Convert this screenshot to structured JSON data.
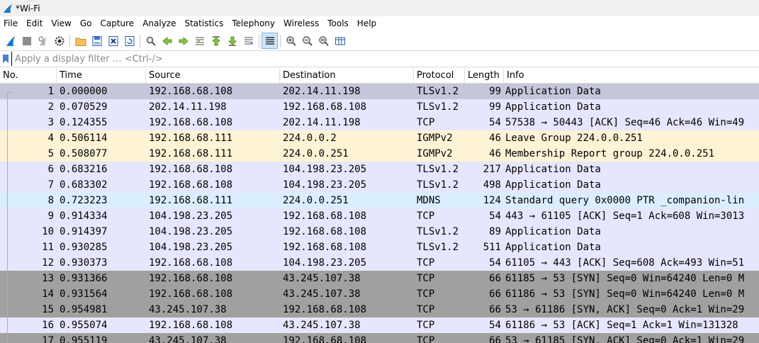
{
  "window": {
    "title": "*Wi-Fi"
  },
  "menu": [
    "File",
    "Edit",
    "View",
    "Go",
    "Capture",
    "Analyze",
    "Statistics",
    "Telephony",
    "Wireless",
    "Tools",
    "Help"
  ],
  "toolbar": {
    "icons": [
      "shark-fin-start-icon",
      "stop-square-icon",
      "restart-capture-icon",
      "capture-options-gear-icon",
      "open-folder-icon",
      "save-file-icon",
      "close-file-icon",
      "reload-file-icon",
      "find-packet-icon",
      "go-back-icon",
      "go-forward-icon",
      "go-to-packet-icon",
      "go-first-icon",
      "go-last-icon",
      "autoscroll-icon",
      "colorize-icon",
      "zoom-in-icon",
      "zoom-out-icon",
      "zoom-normal-icon",
      "resize-columns-icon"
    ]
  },
  "filter": {
    "placeholder": "Apply a display filter … <Ctrl-/>"
  },
  "columns": {
    "no": "No.",
    "time": "Time",
    "source": "Source",
    "destination": "Destination",
    "protocol": "Protocol",
    "length": "Length",
    "info": "Info"
  },
  "colors": {
    "tcp": "#e7e6ff",
    "udp": "#daeeff",
    "igmp": "#fff3d6",
    "syn": "#a0a0a0",
    "selected": "#c5c5d8"
  },
  "packets": [
    {
      "no": "1",
      "time": "0.000000",
      "src": "192.168.68.108",
      "dst": "202.14.11.198",
      "proto": "TLSv1.2",
      "len": "99",
      "info": "Application Data",
      "color": "#c6c6da"
    },
    {
      "no": "2",
      "time": "0.070529",
      "src": "202.14.11.198",
      "dst": "192.168.68.108",
      "proto": "TLSv1.2",
      "len": "99",
      "info": "Application Data",
      "color": "#e7e6ff"
    },
    {
      "no": "3",
      "time": "0.124355",
      "src": "192.168.68.108",
      "dst": "202.14.11.198",
      "proto": "TCP",
      "len": "54",
      "info": "57538 → 50443 [ACK] Seq=46 Ack=46 Win=49",
      "color": "#e7e6ff"
    },
    {
      "no": "4",
      "time": "0.506114",
      "src": "192.168.68.111",
      "dst": "224.0.0.2",
      "proto": "IGMPv2",
      "len": "46",
      "info": "Leave Group 224.0.0.251",
      "color": "#fff3d6"
    },
    {
      "no": "5",
      "time": "0.508077",
      "src": "192.168.68.111",
      "dst": "224.0.0.251",
      "proto": "IGMPv2",
      "len": "46",
      "info": "Membership Report group 224.0.0.251",
      "color": "#fff3d6"
    },
    {
      "no": "6",
      "time": "0.683216",
      "src": "192.168.68.108",
      "dst": "104.198.23.205",
      "proto": "TLSv1.2",
      "len": "217",
      "info": "Application Data",
      "color": "#e7e6ff"
    },
    {
      "no": "7",
      "time": "0.683302",
      "src": "192.168.68.108",
      "dst": "104.198.23.205",
      "proto": "TLSv1.2",
      "len": "498",
      "info": "Application Data",
      "color": "#e7e6ff"
    },
    {
      "no": "8",
      "time": "0.723223",
      "src": "192.168.68.111",
      "dst": "224.0.0.251",
      "proto": "MDNS",
      "len": "124",
      "info": "Standard query 0x0000 PTR _companion-lin",
      "color": "#daeeff"
    },
    {
      "no": "9",
      "time": "0.914334",
      "src": "104.198.23.205",
      "dst": "192.168.68.108",
      "proto": "TCP",
      "len": "54",
      "info": "443 → 61105 [ACK] Seq=1 Ack=608 Win=3013",
      "color": "#e7e6ff"
    },
    {
      "no": "10",
      "time": "0.914397",
      "src": "104.198.23.205",
      "dst": "192.168.68.108",
      "proto": "TLSv1.2",
      "len": "89",
      "info": "Application Data",
      "color": "#e7e6ff"
    },
    {
      "no": "11",
      "time": "0.930285",
      "src": "104.198.23.205",
      "dst": "192.168.68.108",
      "proto": "TLSv1.2",
      "len": "511",
      "info": "Application Data",
      "color": "#e7e6ff"
    },
    {
      "no": "12",
      "time": "0.930373",
      "src": "192.168.68.108",
      "dst": "104.198.23.205",
      "proto": "TCP",
      "len": "54",
      "info": "61105 → 443 [ACK] Seq=608 Ack=493 Win=51",
      "color": "#e7e6ff"
    },
    {
      "no": "13",
      "time": "0.931366",
      "src": "192.168.68.108",
      "dst": "43.245.107.38",
      "proto": "TCP",
      "len": "66",
      "info": "61185 → 53 [SYN] Seq=0 Win=64240 Len=0 M",
      "color": "#a0a0a0"
    },
    {
      "no": "14",
      "time": "0.931564",
      "src": "192.168.68.108",
      "dst": "43.245.107.38",
      "proto": "TCP",
      "len": "66",
      "info": "61186 → 53 [SYN] Seq=0 Win=64240 Len=0 M",
      "color": "#a0a0a0"
    },
    {
      "no": "15",
      "time": "0.954981",
      "src": "43.245.107.38",
      "dst": "192.168.68.108",
      "proto": "TCP",
      "len": "66",
      "info": "53 → 61186 [SYN, ACK] Seq=0 Ack=1 Win=29",
      "color": "#a0a0a0"
    },
    {
      "no": "16",
      "time": "0.955074",
      "src": "192.168.68.108",
      "dst": "43.245.107.38",
      "proto": "TCP",
      "len": "54",
      "info": "61186 → 53 [ACK] Seq=1 Ack=1 Win=131328",
      "color": "#e7e6ff"
    },
    {
      "no": "17",
      "time": "0.955119",
      "src": "43.245.107.38",
      "dst": "192.168.68.108",
      "proto": "TCP",
      "len": "66",
      "info": "53 → 61185 [SYN, ACK] Seq=0 Ack=1 Win=29",
      "color": "#a0a0a0"
    }
  ]
}
